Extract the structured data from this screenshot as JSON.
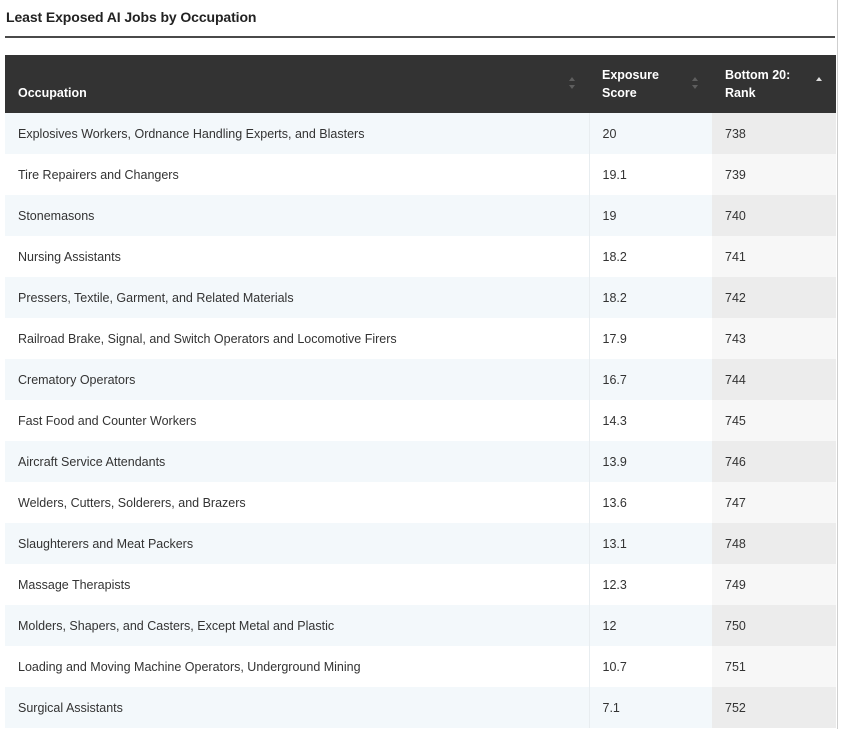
{
  "title": "Least Exposed AI Jobs by Occupation",
  "chart_data": {
    "type": "table",
    "title": "Least Exposed AI Jobs by Occupation",
    "columns": [
      "Occupation",
      "Exposure Score",
      "Bottom 20: Rank"
    ],
    "header_lines": [
      [
        "Occupation"
      ],
      [
        "Exposure",
        "Score"
      ],
      [
        "Bottom 20:",
        "Rank"
      ]
    ],
    "sorted_column": "Bottom 20: Rank",
    "sort_direction": "ascending",
    "rows": [
      {
        "occupation": "Explosives Workers, Ordnance Handling Experts, and Blasters",
        "score": "20",
        "rank": "738"
      },
      {
        "occupation": "Tire Repairers and Changers",
        "score": "19.1",
        "rank": "739"
      },
      {
        "occupation": "Stonemasons",
        "score": "19",
        "rank": "740"
      },
      {
        "occupation": "Nursing Assistants",
        "score": "18.2",
        "rank": "741"
      },
      {
        "occupation": "Pressers, Textile, Garment, and Related Materials",
        "score": "18.2",
        "rank": "742"
      },
      {
        "occupation": "Railroad Brake, Signal, and Switch Operators and Locomotive Firers",
        "score": "17.9",
        "rank": "743"
      },
      {
        "occupation": "Crematory Operators",
        "score": "16.7",
        "rank": "744"
      },
      {
        "occupation": "Fast Food and Counter Workers",
        "score": "14.3",
        "rank": "745"
      },
      {
        "occupation": "Aircraft Service Attendants",
        "score": "13.9",
        "rank": "746"
      },
      {
        "occupation": "Welders, Cutters, Solderers, and Brazers",
        "score": "13.6",
        "rank": "747"
      },
      {
        "occupation": "Slaughterers and Meat Packers",
        "score": "13.1",
        "rank": "748"
      },
      {
        "occupation": "Massage Therapists",
        "score": "12.3",
        "rank": "749"
      },
      {
        "occupation": "Molders, Shapers, and Casters, Except Metal and Plastic",
        "score": "12",
        "rank": "750"
      },
      {
        "occupation": "Loading and Moving Machine Operators, Underground Mining",
        "score": "10.7",
        "rank": "751"
      },
      {
        "occupation": "Surgical Assistants",
        "score": "7.1",
        "rank": "752"
      }
    ]
  },
  "colors": {
    "header_bg": "#333333",
    "header_text": "#ffffff",
    "row_alt_bg": "#f3f8fb",
    "rank_col_bg": "#ececec"
  },
  "icons": {
    "sort": "sort-arrows-icon",
    "sort_active": "sort-ascending-icon"
  }
}
